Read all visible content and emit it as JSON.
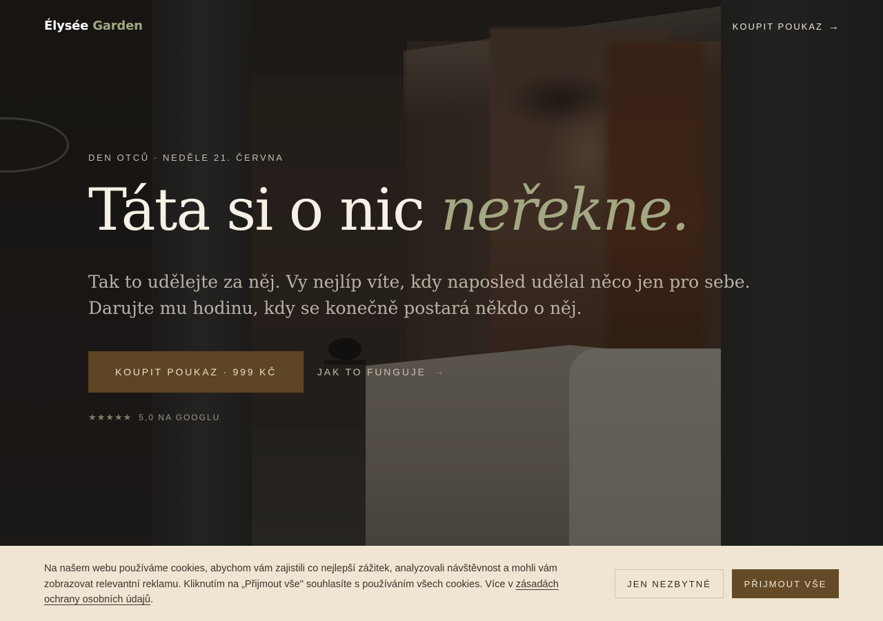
{
  "header": {
    "logo_primary": "Élysée",
    "logo_accent": "Garden",
    "cta_label": "KOUPIT POUKAZ",
    "cta_arrow": "→"
  },
  "hero": {
    "eyebrow": "DEN OTCŮ · NEDĚLE 21. ČERVNA",
    "headline_main": "Táta si o nic ",
    "headline_emphasis": "neřekne.",
    "subtext": "Tak to udělejte za něj. Vy nejlíp víte, kdy naposled udělal něco jen pro sebe. Darujte mu hodinu, kdy se konečně postará někdo o něj.",
    "primary_cta": "KOUPIT POUKAZ · 999 KČ",
    "secondary_cta": "JAK TO FUNGUJE",
    "secondary_arrow": "→",
    "rating_stars": "★★★★★",
    "rating_value": 5.0,
    "rating_text": "5,0 NA GOOGLU"
  },
  "cookie": {
    "text": "Na našem webu používáme cookies, abychom vám zajistili co nejlepší zážitek, analyzovali návštěvnost a mohli vám zobrazovat relevantní reklamu. Kliknutím na „Přijmout vše\" souhlasíte s používáním všech cookies. Více v ",
    "link_text": "zásadách ochrany osobních údajů",
    "suffix": ".",
    "necessary_button": "JEN NEZBYTNÉ",
    "accept_button": "PŘIJMOUT VŠE"
  },
  "colors": {
    "accent_green": "#a3a782",
    "primary_brown": "#5d4523",
    "cookie_bg": "#efe5d2",
    "accept_button": "#644a26"
  },
  "icons": {
    "header_arrow": "arrow-right-icon",
    "secondary_arrow": "arrow-right-icon",
    "stars": "star-icon"
  }
}
